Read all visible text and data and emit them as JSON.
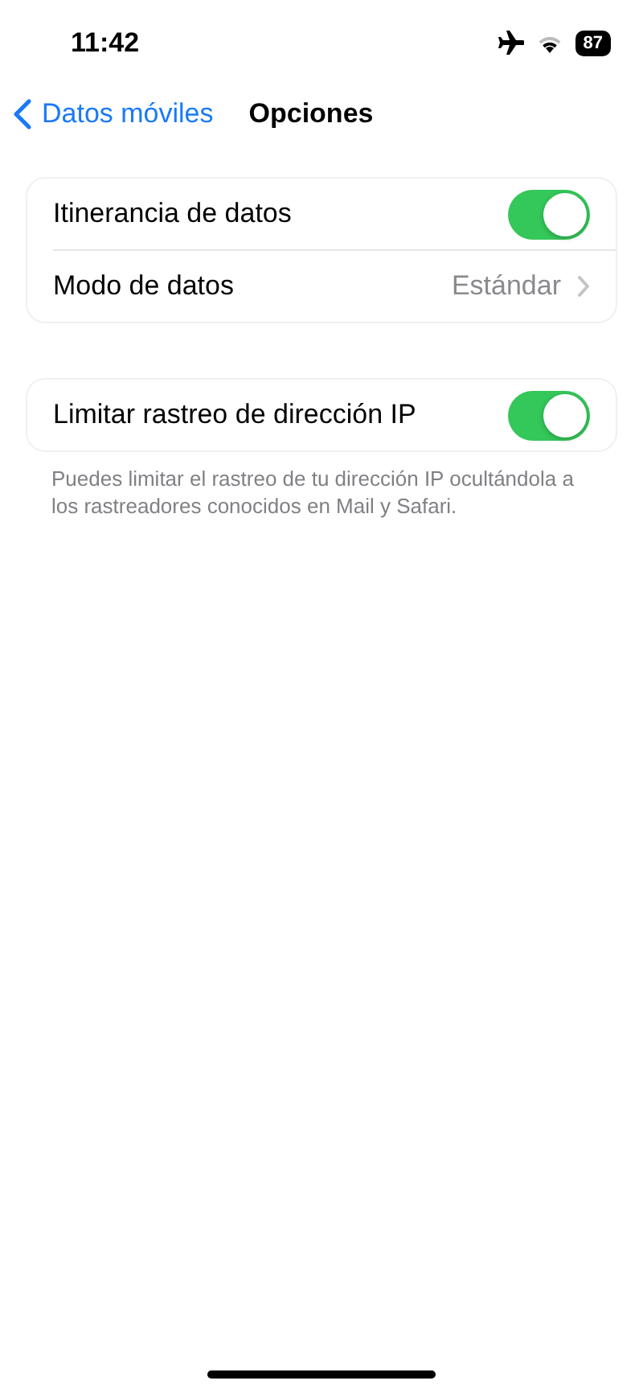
{
  "status_bar": {
    "time": "11:42",
    "battery": "87"
  },
  "nav": {
    "back": "Datos móviles",
    "title": "Opciones"
  },
  "groups": [
    {
      "rows": [
        {
          "kind": "toggle",
          "label": "Itinerancia de datos",
          "on": true
        },
        {
          "kind": "link",
          "label": "Modo de datos",
          "value": "Estándar"
        }
      ]
    },
    {
      "rows": [
        {
          "kind": "toggle",
          "label": "Limitar rastreo de dirección IP",
          "on": true
        }
      ],
      "footer": "Puedes limitar el rastreo de tu dirección IP ocultándola a los rastreadores conocidos en Mail y Safari."
    }
  ]
}
